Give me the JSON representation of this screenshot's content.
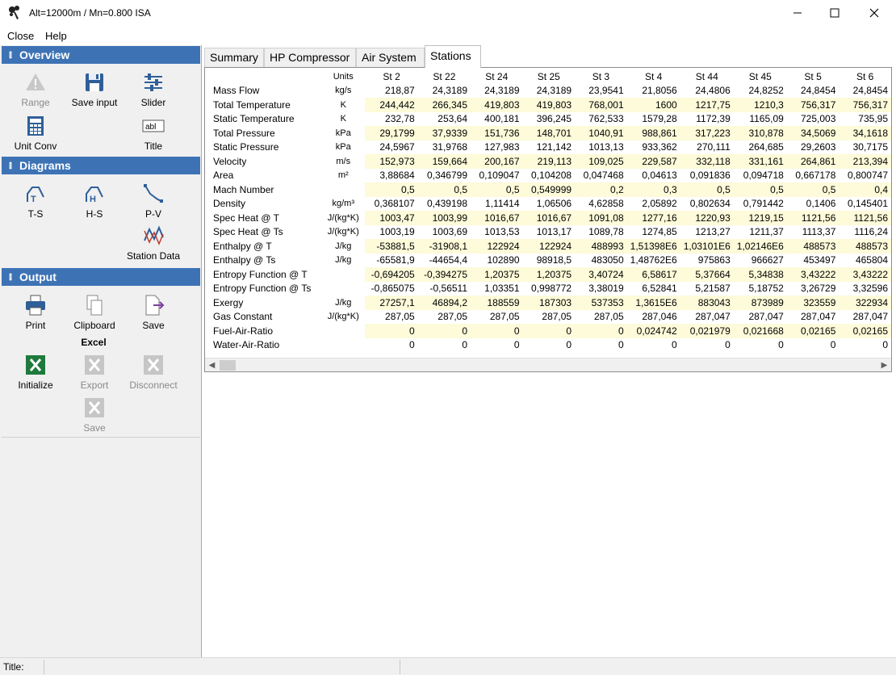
{
  "window": {
    "title": "Alt=12000m / Mn=0.800 ISA"
  },
  "menu": [
    "Close",
    "Help"
  ],
  "sidebar": {
    "overview": {
      "header": "Overview",
      "tools": [
        {
          "label": "Range",
          "icon": "warning-icon"
        },
        {
          "label": "Save input",
          "icon": "floppy-icon"
        },
        {
          "label": "Slider",
          "icon": "slider-icon"
        },
        {
          "label": "Unit Conv",
          "icon": "calculator-icon"
        },
        {
          "label": "Title",
          "icon": "text-field-icon"
        }
      ]
    },
    "diagrams": {
      "header": "Diagrams",
      "tools": [
        {
          "label": "T-S",
          "icon": "ts-diagram-icon"
        },
        {
          "label": "H-S",
          "icon": "hs-diagram-icon"
        },
        {
          "label": "P-V",
          "icon": "pv-diagram-icon"
        },
        {
          "label": "Station Data",
          "icon": "station-data-icon"
        }
      ]
    },
    "output": {
      "header": "Output",
      "tools": [
        {
          "label": "Print",
          "icon": "printer-icon"
        },
        {
          "label": "Clipboard",
          "icon": "clipboard-icon"
        },
        {
          "label": "Save",
          "icon": "save-export-icon"
        }
      ],
      "excel_label": "Excel",
      "excel_tools": [
        {
          "label": "Initialize",
          "icon": "excel-icon"
        },
        {
          "label": "Export",
          "icon": "excel-export-icon"
        },
        {
          "label": "Disconnect",
          "icon": "excel-disconnect-icon"
        },
        {
          "label": "Save",
          "icon": "excel-save-icon"
        }
      ]
    }
  },
  "tabs": [
    {
      "label": "Summary",
      "active": false
    },
    {
      "label": "HP Compressor",
      "active": false
    },
    {
      "label": "Air System",
      "active": false
    },
    {
      "label": "Stations",
      "active": true
    }
  ],
  "table": {
    "units_header": "Units",
    "stations": [
      "St 2",
      "St 22",
      "St 24",
      "St 25",
      "St 3",
      "St 4",
      "St 44",
      "St 45",
      "St 5",
      "St 6"
    ],
    "rows": [
      {
        "label": "Mass Flow",
        "unit": "kg/s",
        "values": [
          "218,87",
          "24,3189",
          "24,3189",
          "24,3189",
          "23,9541",
          "21,8056",
          "24,4806",
          "24,8252",
          "24,8454",
          "24,8454"
        ]
      },
      {
        "label": "Total Temperature",
        "unit": "K",
        "values": [
          "244,442",
          "266,345",
          "419,803",
          "419,803",
          "768,001",
          "1600",
          "1217,75",
          "1210,3",
          "756,317",
          "756,317"
        ]
      },
      {
        "label": "Static Temperature",
        "unit": "K",
        "values": [
          "232,78",
          "253,64",
          "400,181",
          "396,245",
          "762,533",
          "1579,28",
          "1172,39",
          "1165,09",
          "725,003",
          "735,95"
        ]
      },
      {
        "label": "Total Pressure",
        "unit": "kPa",
        "values": [
          "29,1799",
          "37,9339",
          "151,736",
          "148,701",
          "1040,91",
          "988,861",
          "317,223",
          "310,878",
          "34,5069",
          "34,1618"
        ]
      },
      {
        "label": "Static Pressure",
        "unit": "kPa",
        "values": [
          "24,5967",
          "31,9768",
          "127,983",
          "121,142",
          "1013,13",
          "933,362",
          "270,111",
          "264,685",
          "29,2603",
          "30,7175"
        ]
      },
      {
        "label": "Velocity",
        "unit": "m/s",
        "values": [
          "152,973",
          "159,664",
          "200,167",
          "219,113",
          "109,025",
          "229,587",
          "332,118",
          "331,161",
          "264,861",
          "213,394"
        ]
      },
      {
        "label": "Area",
        "unit": "m²",
        "values": [
          "3,88684",
          "0,346799",
          "0,109047",
          "0,104208",
          "0,047468",
          "0,04613",
          "0,091836",
          "0,094718",
          "0,667178",
          "0,800747"
        ]
      },
      {
        "label": "Mach Number",
        "unit": "",
        "values": [
          "0,5",
          "0,5",
          "0,5",
          "0,549999",
          "0,2",
          "0,3",
          "0,5",
          "0,5",
          "0,5",
          "0,4"
        ]
      },
      {
        "label": "Density",
        "unit": "kg/m³",
        "values": [
          "0,368107",
          "0,439198",
          "1,11414",
          "1,06506",
          "4,62858",
          "2,05892",
          "0,802634",
          "0,791442",
          "0,1406",
          "0,145401"
        ]
      },
      {
        "label": "Spec Heat @ T",
        "unit": "J/(kg*K)",
        "values": [
          "1003,47",
          "1003,99",
          "1016,67",
          "1016,67",
          "1091,08",
          "1277,16",
          "1220,93",
          "1219,15",
          "1121,56",
          "1121,56"
        ]
      },
      {
        "label": "Spec Heat @ Ts",
        "unit": "J/(kg*K)",
        "values": [
          "1003,19",
          "1003,69",
          "1013,53",
          "1013,17",
          "1089,78",
          "1274,85",
          "1213,27",
          "1211,37",
          "1113,37",
          "1116,24"
        ]
      },
      {
        "label": "Enthalpy @ T",
        "unit": "J/kg",
        "values": [
          "-53881,5",
          "-31908,1",
          "122924",
          "122924",
          "488993",
          "1,51398E6",
          "1,03101E6",
          "1,02146E6",
          "488573",
          "488573"
        ]
      },
      {
        "label": "Enthalpy @ Ts",
        "unit": "J/kg",
        "values": [
          "-65581,9",
          "-44654,4",
          "102890",
          "98918,5",
          "483050",
          "1,48762E6",
          "975863",
          "966627",
          "453497",
          "465804"
        ]
      },
      {
        "label": "Entropy Function @ T",
        "unit": "",
        "values": [
          "-0,694205",
          "-0,394275",
          "1,20375",
          "1,20375",
          "3,40724",
          "6,58617",
          "5,37664",
          "5,34838",
          "3,43222",
          "3,43222"
        ]
      },
      {
        "label": "Entropy Function @ Ts",
        "unit": "",
        "values": [
          "-0,865075",
          "-0,56511",
          "1,03351",
          "0,998772",
          "3,38019",
          "6,52841",
          "5,21587",
          "5,18752",
          "3,26729",
          "3,32596"
        ]
      },
      {
        "label": "Exergy",
        "unit": "J/kg",
        "values": [
          "27257,1",
          "46894,2",
          "188559",
          "187303",
          "537353",
          "1,3615E6",
          "883043",
          "873989",
          "323559",
          "322934"
        ]
      },
      {
        "label": "Gas Constant",
        "unit": "J/(kg*K)",
        "values": [
          "287,05",
          "287,05",
          "287,05",
          "287,05",
          "287,05",
          "287,046",
          "287,047",
          "287,047",
          "287,047",
          "287,047"
        ]
      },
      {
        "label": "Fuel-Air-Ratio",
        "unit": "",
        "values": [
          "0",
          "0",
          "0",
          "0",
          "0",
          "0,024742",
          "0,021979",
          "0,021668",
          "0,02165",
          "0,02165"
        ]
      },
      {
        "label": "Water-Air-Ratio",
        "unit": "",
        "values": [
          "0",
          "0",
          "0",
          "0",
          "0",
          "0",
          "0",
          "0",
          "0",
          "0"
        ]
      }
    ]
  },
  "statusbar": {
    "title_label": "Title:"
  },
  "colors": {
    "section_header": "#3d73b5",
    "row_shade": "#fdfbd9",
    "excel_green": "#1e7a3c"
  }
}
